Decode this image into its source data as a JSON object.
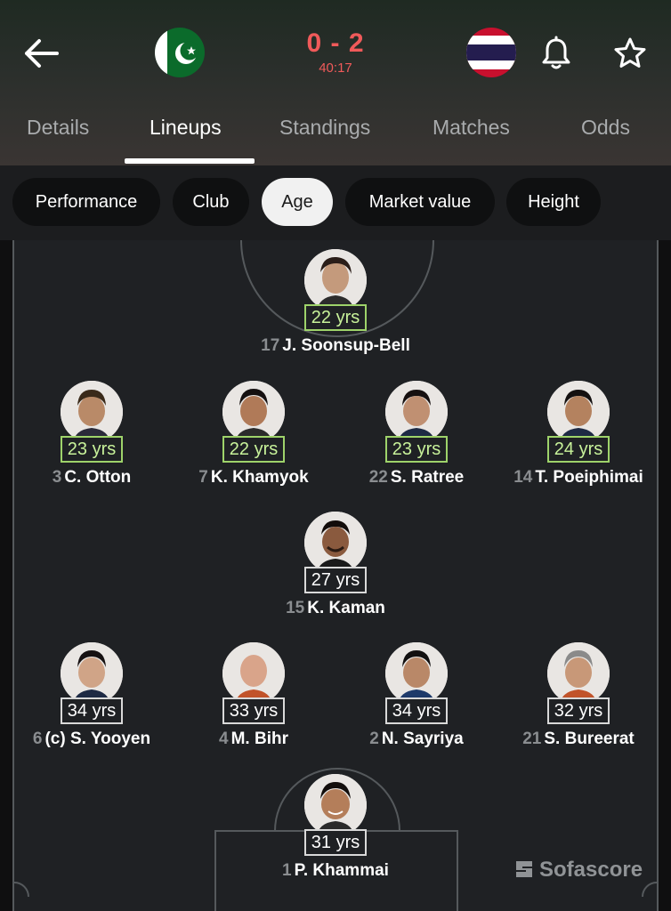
{
  "match": {
    "home_team_flag": "pakistan-flag",
    "away_team_flag": "thailand-flag",
    "score": "0 - 2",
    "clock": "40:17",
    "score_color": "#f05a5a"
  },
  "tabs": [
    "Details",
    "Lineups",
    "Standings",
    "Matches",
    "Odds"
  ],
  "active_tab": "Lineups",
  "filters": [
    "Performance",
    "Club",
    "Age",
    "Market value",
    "Height"
  ],
  "active_filter": "Age",
  "players": [
    {
      "num": "17",
      "name": "J. Soonsup-Bell",
      "age": "22 yrs",
      "highlight": true
    },
    {
      "num": "3",
      "name": "C. Otton",
      "age": "23 yrs",
      "highlight": true
    },
    {
      "num": "7",
      "name": "K. Khamyok",
      "age": "22 yrs",
      "highlight": true
    },
    {
      "num": "22",
      "name": "S. Ratree",
      "age": "23 yrs",
      "highlight": true
    },
    {
      "num": "14",
      "name": "T. Poeiphimai",
      "age": "24 yrs",
      "highlight": true
    },
    {
      "num": "15",
      "name": "K. Kaman",
      "age": "27 yrs",
      "highlight": false
    },
    {
      "num": "6",
      "name": "(c) S. Yooyen",
      "age": "34 yrs",
      "highlight": false
    },
    {
      "num": "4",
      "name": "M. Bihr",
      "age": "33 yrs",
      "highlight": false
    },
    {
      "num": "2",
      "name": "N. Sayriya",
      "age": "34 yrs",
      "highlight": false
    },
    {
      "num": "21",
      "name": "S. Bureerat",
      "age": "32 yrs",
      "highlight": false
    },
    {
      "num": "1",
      "name": "P. Khammai",
      "age": "31 yrs",
      "highlight": false
    }
  ],
  "branding": "Sofascore",
  "colors": {
    "highlight_green": "#9ed36a",
    "pitch": "#1f2124",
    "accent_red": "#f05a5a"
  }
}
